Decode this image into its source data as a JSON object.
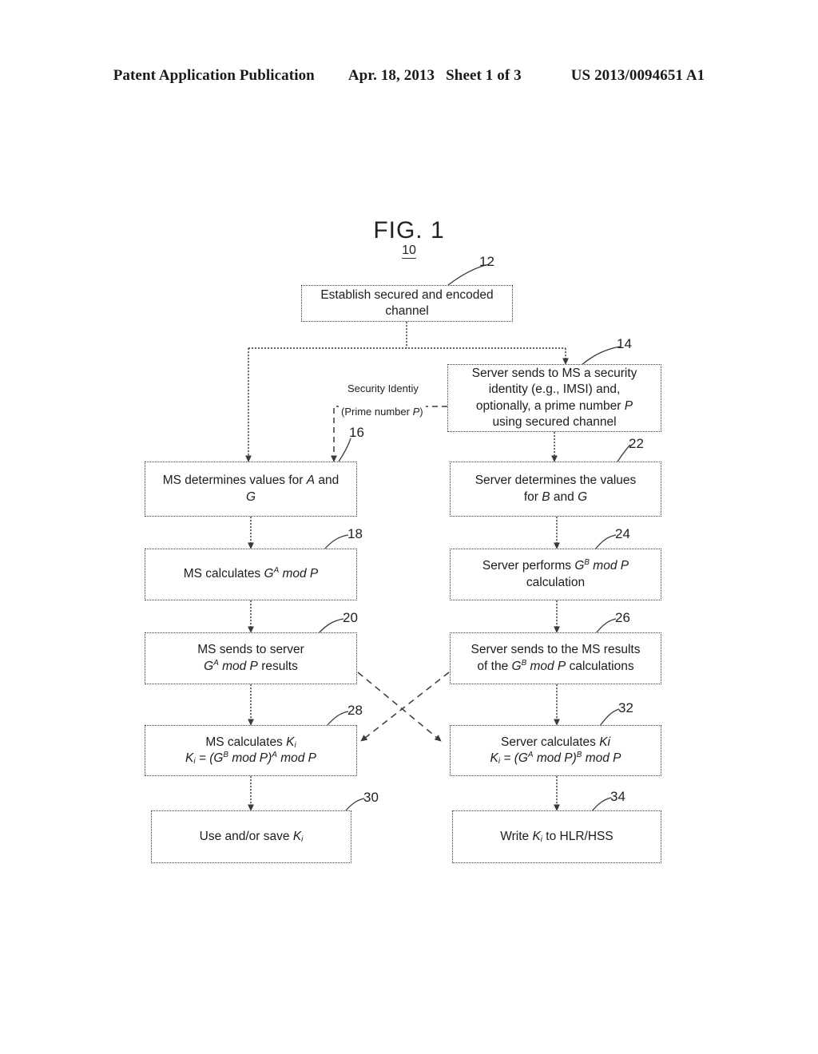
{
  "header": {
    "publication": "Patent Application Publication",
    "date": "Apr. 18, 2013",
    "sheet": "Sheet 1 of 3",
    "patent_number": "US 2013/0094651 A1"
  },
  "figure": {
    "title": "FIG. 1",
    "number": "10"
  },
  "refs": {
    "r12": "12",
    "r14": "14",
    "r16": "16",
    "r18": "18",
    "r20": "20",
    "r22": "22",
    "r24": "24",
    "r26": "26",
    "r28": "28",
    "r30": "30",
    "r32": "32",
    "r34": "34"
  },
  "boxes": {
    "b12": {
      "line1": "Establish secured and encoded",
      "line2": "channel"
    },
    "b14": {
      "line1": "Server sends to MS a security",
      "line2": "identity (e.g., IMSI) and,",
      "line3_a": "optionally, a prime number ",
      "line3_b": "P",
      "line4": "using secured channel"
    },
    "b16": {
      "line1_a": "MS determines values for ",
      "line1_b": "A",
      "line1_c": " and",
      "line2": "G"
    },
    "b18": {
      "a": "MS calculates ",
      "b": "G",
      "sup": "A",
      "c": " mod P"
    },
    "b20": {
      "line1": "MS sends to server",
      "line2_a": "G",
      "line2_sup": "A",
      "line2_b": " mod P",
      "line2_c": " results"
    },
    "b22": {
      "line1": "Server determines the values",
      "line2_a": "for ",
      "line2_b": "B",
      "line2_c": " and ",
      "line2_d": "G"
    },
    "b24": {
      "line1_a": "Server performs ",
      "line1_b": "G",
      "line1_sup": "B",
      "line1_c": " mod P",
      "line2": "calculation"
    },
    "b26": {
      "line1": "Server sends to the MS results",
      "line2_a": "of the ",
      "line2_b": "G",
      "line2_sup": "B",
      "line2_c": " mod P",
      "line2_d": " calculations"
    },
    "b28": {
      "line1_a": "MS calculates ",
      "line1_b": "K",
      "line1_sub": "i",
      "line2_a": "K",
      "line2_sub": "i",
      "line2_b": " = (G",
      "line2_sup1": "B",
      "line2_c": " mod P)",
      "line2_sup2": "A",
      "line2_d": " mod P"
    },
    "b30": {
      "a": "Use and/or save ",
      "b": "K",
      "sub": "i"
    },
    "b32": {
      "line1_a": "Server calculates ",
      "line1_b": "Ki",
      "line2_a": "K",
      "line2_sub": "i",
      "line2_b": " = (G",
      "line2_sup1": "A",
      "line2_c": " mod P)",
      "line2_sup2": "B",
      "line2_d": " mod P"
    },
    "b34": {
      "a": "Write ",
      "b": "K",
      "sub": "i",
      "c": " to HLR/HSS"
    }
  },
  "wire_labels": {
    "security_identity": "Security Identiy",
    "prime_number_a": "(Prime number ",
    "prime_number_b": "P",
    "prime_number_c": ")"
  },
  "colors": {
    "ink": "#1a1a1a",
    "box_border": "#3a3a3a",
    "page_bg": "#ffffff"
  }
}
